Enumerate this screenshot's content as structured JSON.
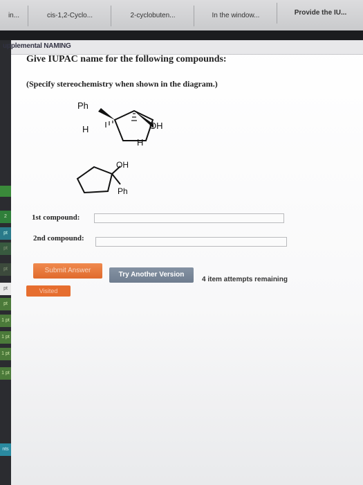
{
  "browser": {
    "tabs": [
      {
        "label": "in..."
      },
      {
        "label": "cis-1,2-Cyclo..."
      },
      {
        "label": "2-cyclobuten..."
      },
      {
        "label": "In the window..."
      },
      {
        "label": "Provide the IU..."
      }
    ]
  },
  "sidebar": {
    "items": [
      {
        "label": ""
      },
      {
        "label": "2"
      },
      {
        "label": "pt"
      },
      {
        "label": "pt"
      },
      {
        "label": "pt"
      },
      {
        "label": "pt"
      },
      {
        "label": "pt"
      },
      {
        "label": "1 pt"
      },
      {
        "label": "1 pt"
      },
      {
        "label": "1 pt"
      },
      {
        "label": "1 pt"
      },
      {
        "label": "nts"
      }
    ]
  },
  "section": {
    "title": "upplemental NAMING"
  },
  "question": {
    "line1": "Give IUPAC name for the following compounds:",
    "line2": "(Specify stereochemistry when shown in the diagram.)"
  },
  "molecules": {
    "m1": {
      "ph": "Ph",
      "h_left": "H",
      "oh": "OH",
      "h_bottom": "H"
    },
    "m2": {
      "oh": "OH",
      "ph": "Ph"
    }
  },
  "fields": {
    "first": {
      "label": "1st compound:",
      "value": ""
    },
    "second": {
      "label": "2nd compound:",
      "value": ""
    }
  },
  "buttons": {
    "submit": "Submit Answer",
    "try_another": "Try Another Version",
    "visited": "Visited"
  },
  "attempts": "4 item attempts remaining"
}
